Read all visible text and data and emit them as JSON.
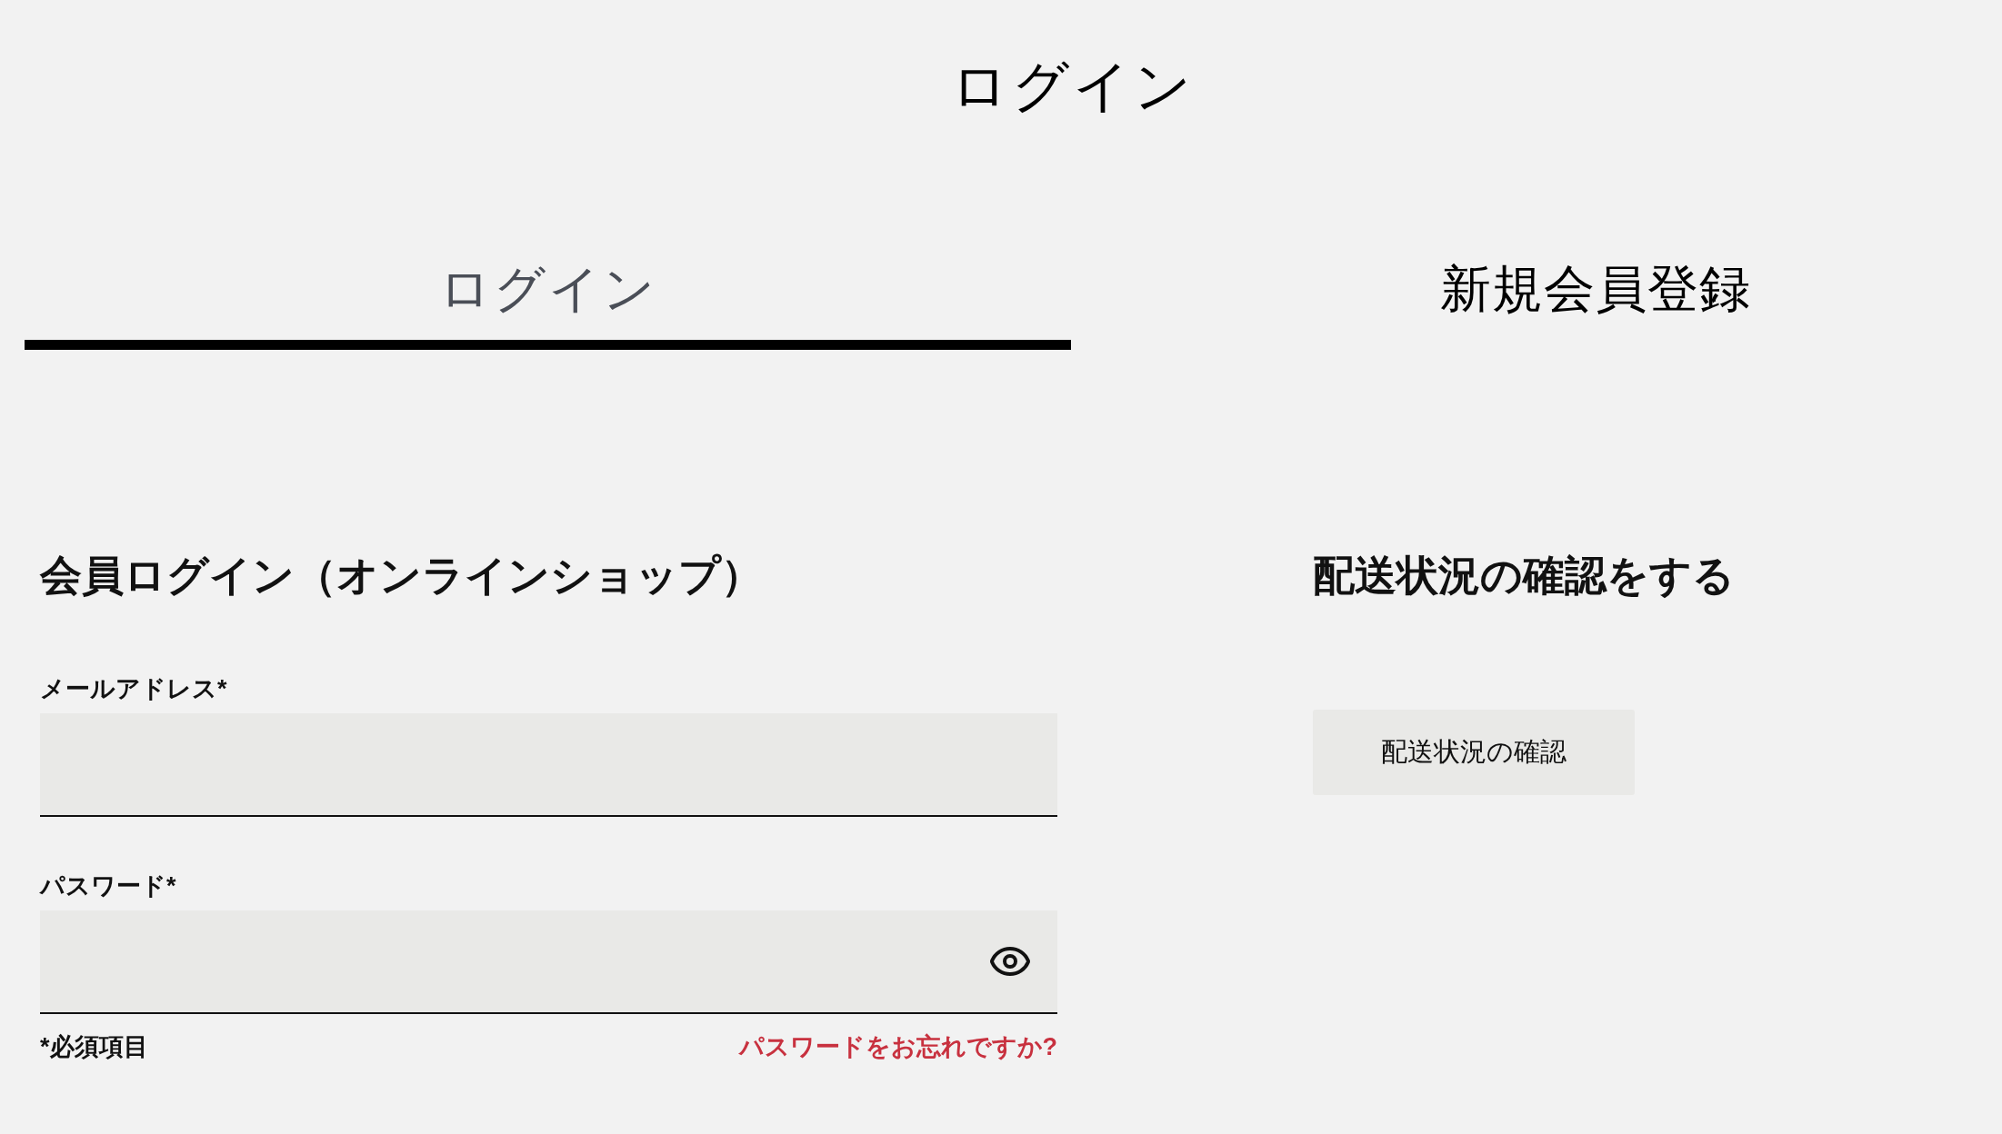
{
  "page_title": "ログイン",
  "tabs": [
    {
      "label": "ログイン",
      "selected": true
    },
    {
      "label": "新規会員登録",
      "selected": false
    }
  ],
  "login_section": {
    "heading": "会員ログイン（オンラインショップ）",
    "fields": [
      {
        "kind": "text",
        "label": "メールアドレス*"
      },
      {
        "kind": "password",
        "label": "パスワード*"
      }
    ],
    "required_note": "*必須項目",
    "forgot_link": "パスワードをお忘れですか?"
  },
  "delivery_section": {
    "heading": "配送状況の確認をする",
    "button": "配送状況の確認"
  }
}
